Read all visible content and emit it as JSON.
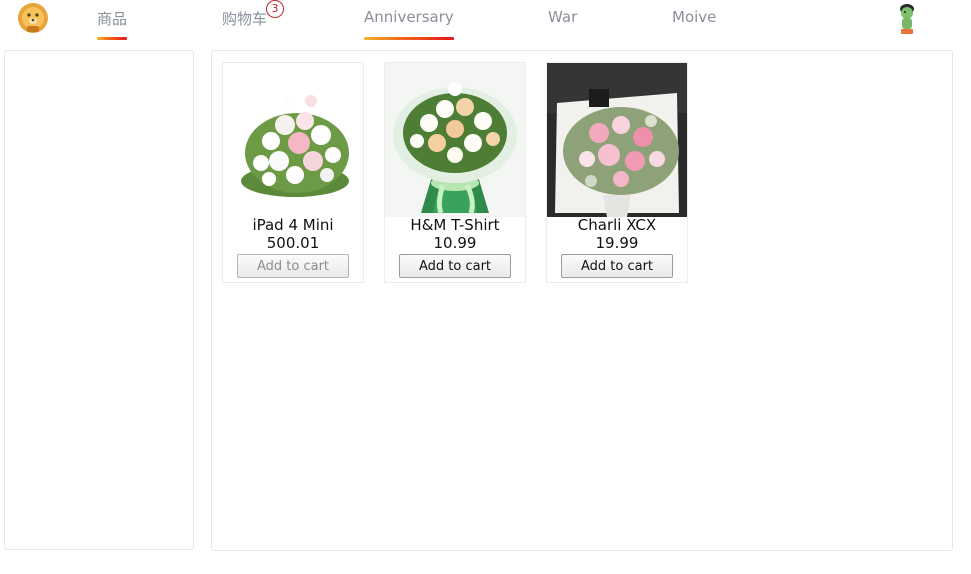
{
  "nav": {
    "items": [
      {
        "label": "商品",
        "active": true,
        "badge": ""
      },
      {
        "label": "购物车",
        "active": false,
        "badge": "3"
      },
      {
        "label": "Anniversary",
        "active": true,
        "badge": ""
      },
      {
        "label": "War",
        "active": false,
        "badge": ""
      },
      {
        "label": "Moive",
        "active": false,
        "badge": ""
      }
    ]
  },
  "products": [
    {
      "name": "iPad 4 Mini",
      "price": "500.01",
      "button": "Add to cart",
      "disabled": true
    },
    {
      "name": "H&M T-Shirt",
      "price": "10.99",
      "button": "Add to cart",
      "disabled": false
    },
    {
      "name": "Charli XCX",
      "price": "19.99",
      "button": "Add to cart",
      "disabled": false
    }
  ],
  "colors": {
    "nav_text": "#8a8f99",
    "underline_start": "#f7b42c",
    "underline_end": "#e3171b",
    "badge": "#c0262d",
    "border": "#e6e6e6"
  },
  "icons": {
    "logo": "lion-logo-icon",
    "user": "user-avatar-icon",
    "product_images": [
      "white-pink-bouquet-image",
      "lily-rose-bouquet-image",
      "pink-rose-bouquet-image"
    ]
  }
}
